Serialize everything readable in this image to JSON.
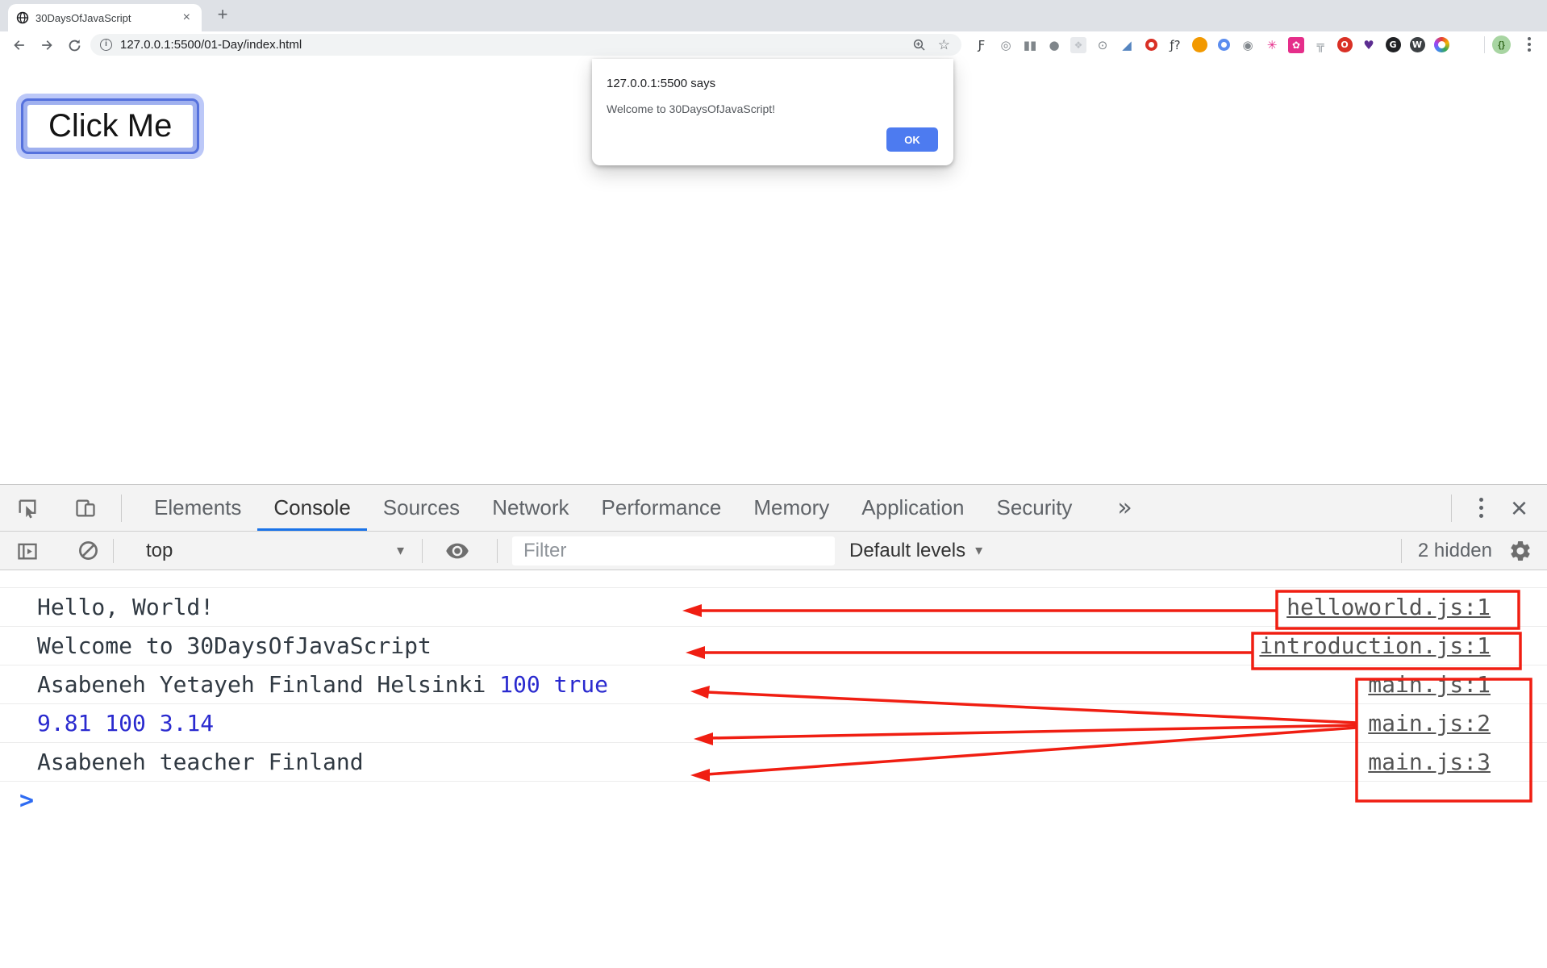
{
  "browser": {
    "tab_title": "30DaysOfJavaScript",
    "tab_close_glyph": "×",
    "new_tab_glyph": "+",
    "url": "127.0.0.1:5500/01-Day/index.html",
    "info_glyph": "i",
    "star_glyph": "☆",
    "profile_glyph": "{}",
    "extensions": [
      {
        "name": "script-f-icon",
        "kind": "glyph",
        "glyph": "Ƒ",
        "color": "#3c4043"
      },
      {
        "name": "target-icon",
        "kind": "glyph",
        "glyph": "◎",
        "color": "#80868b"
      },
      {
        "name": "columns-icon",
        "kind": "glyph",
        "glyph": "▮▮",
        "color": "#80868b"
      },
      {
        "name": "bug-icon",
        "kind": "glyph",
        "glyph": "●",
        "color": "#80868b"
      },
      {
        "name": "grid-icon",
        "kind": "tile",
        "glyph": "❖",
        "color": "#bdc1c6",
        "bg": "#e8eaed"
      },
      {
        "name": "brackets-circle-icon",
        "kind": "glyph",
        "glyph": "⊙",
        "color": "#80868b"
      },
      {
        "name": "eyedropper-icon",
        "kind": "glyph",
        "glyph": "◢",
        "color": "#5585c0"
      },
      {
        "name": "stop-ring-icon",
        "kind": "ring",
        "color": "#d93025"
      },
      {
        "name": "fn-question-icon",
        "kind": "glyph",
        "glyph": "ƒ?",
        "color": "#3c4043"
      },
      {
        "name": "megaphone-icon",
        "kind": "dot",
        "glyph": "",
        "color": "#f29900"
      },
      {
        "name": "swirl-icon",
        "kind": "ring",
        "color": "#5b8def"
      },
      {
        "name": "camera-icon",
        "kind": "glyph",
        "glyph": "◉",
        "color": "#80868b"
      },
      {
        "name": "pink-atom-icon",
        "kind": "glyph",
        "glyph": "✳",
        "color": "#e52e8a"
      },
      {
        "name": "pink-gear-icon",
        "kind": "tile",
        "glyph": "✿",
        "color": "#ffffff",
        "bg": "#e52e8a"
      },
      {
        "name": "blocks-icon",
        "kind": "glyph",
        "glyph": "╦",
        "color": "#9aa0a6"
      },
      {
        "name": "red-o-icon",
        "kind": "dot",
        "glyph": "O",
        "color": "#d93025"
      },
      {
        "name": "heart-lens-icon",
        "kind": "glyph",
        "glyph": "♥",
        "color": "#5c2d91"
      },
      {
        "name": "power-circle-icon",
        "kind": "dot",
        "glyph": "G",
        "color": "#202124"
      },
      {
        "name": "w-circle-icon",
        "kind": "dot",
        "glyph": "W",
        "color": "#3c4043"
      },
      {
        "name": "color-wheel-icon",
        "kind": "wheel",
        "glyph": "",
        "color": ""
      }
    ]
  },
  "page": {
    "button_label": "Click Me"
  },
  "dialog": {
    "title": "127.0.0.1:5500 says",
    "message": "Welcome to 30DaysOfJavaScript!",
    "ok_label": "OK",
    "ok_color": "#4d7bf0"
  },
  "devtools": {
    "tabs": [
      {
        "label": "Elements",
        "active": false
      },
      {
        "label": "Console",
        "active": true
      },
      {
        "label": "Sources",
        "active": false
      },
      {
        "label": "Network",
        "active": false
      },
      {
        "label": "Performance",
        "active": false
      },
      {
        "label": "Memory",
        "active": false
      },
      {
        "label": "Application",
        "active": false
      },
      {
        "label": "Security",
        "active": false
      }
    ],
    "overflow_glyph": "»",
    "close_glyph": "×",
    "toolbar": {
      "context": "top",
      "caret_glyph": "▾",
      "filter_placeholder": "Filter",
      "levels_label": "Default levels",
      "hidden_badge": "2 hidden"
    },
    "console": {
      "rows": [
        {
          "segments": [
            {
              "text": "Hello, World!",
              "kind": "text"
            }
          ],
          "link": "helloworld.js:1"
        },
        {
          "segments": [
            {
              "text": "Welcome to 30DaysOfJavaScript",
              "kind": "text"
            }
          ],
          "link": "introduction.js:1"
        },
        {
          "segments": [
            {
              "text": "Asabeneh Yetayeh Finland Helsinki ",
              "kind": "text"
            },
            {
              "text": "100 true",
              "kind": "value"
            }
          ],
          "link": "main.js:1"
        },
        {
          "segments": [
            {
              "text": "9.81 100 3.14",
              "kind": "value"
            }
          ],
          "link": "main.js:2"
        },
        {
          "segments": [
            {
              "text": "Asabeneh teacher Finland",
              "kind": "text"
            }
          ],
          "link": "main.js:3"
        }
      ],
      "prompt_glyph": ">"
    },
    "colors": {
      "accent": "#1a73e8",
      "value_blue": "#2a2acf",
      "console_text": "#303942",
      "link": "#545454"
    }
  },
  "annotations": {
    "color": "#f01e12"
  }
}
